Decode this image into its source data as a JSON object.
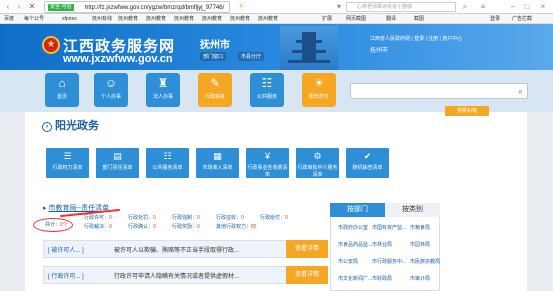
{
  "browser": {
    "safe_label": "安全·可信",
    "url": "http://fz.jxzwfww.gov.cn/ygzw/bmzrqd/bmfljyj_97746/",
    "search_placeholder": "心疼老师赋诗说道小猫咖",
    "bookmarks": [
      "百度",
      "每个公号",
      "sfpnes",
      "抚州有线",
      "抚州教育",
      "抚州教育",
      "抚州教育",
      "抚州教育",
      "抚州教育",
      "抚州教育"
    ],
    "right_tools": [
      "扩展",
      "网页截图",
      "翻译",
      "截图",
      "登录",
      "广告拦截"
    ]
  },
  "header": {
    "emblem_glyph": "★",
    "site_name": "江西政务服务网",
    "domain": "www.jxzwfww.gov.cn",
    "city": "抚州市",
    "dept_pill": "部门窗口",
    "county_pill": "市县分厅",
    "top_links": "江西省人民政府网  |  登录  |  注册  |  用户中心",
    "top_city": "抚州市"
  },
  "menu": [
    {
      "label": "首页",
      "glyph": "⌂",
      "color": "#2e8fd6"
    },
    {
      "label": "个人办事",
      "glyph": "☺",
      "color": "#2e8fd6"
    },
    {
      "label": "法人办事",
      "glyph": "♜",
      "color": "#2e8fd6"
    },
    {
      "label": "行政审批",
      "glyph": "✎",
      "color": "#f5a623"
    },
    {
      "label": "公共服务",
      "glyph": "☷",
      "color": "#2e8fd6"
    },
    {
      "label": "阳光政务",
      "glyph": "☀",
      "color": "#f5a623"
    }
  ],
  "yjfk_label": "我要纠错",
  "section_title": "阳光政务",
  "tabs": [
    "行政权力清单",
    "部门责任清单",
    "公共服务清单",
    "市场准入清单",
    "行政事业性收费清单",
    "行政审批中介服务清单",
    "随机抽查清单"
  ],
  "list": {
    "title": "市教育局--责任清单",
    "stats": [
      {
        "label": "共计：",
        "value": "0个"
      },
      {
        "label": "行政许可：",
        "value": "0"
      },
      {
        "label": "行政处罚：",
        "value": "0"
      },
      {
        "label": "行政强制：",
        "value": "0"
      },
      {
        "label": "行政征收：",
        "value": "0"
      },
      {
        "label": "行政给付：",
        "value": "0"
      },
      {
        "label": "行政裁决：",
        "value": "0"
      },
      {
        "label": "行政确认：",
        "value": "0"
      },
      {
        "label": "行政奖励：",
        "value": "0"
      },
      {
        "label": "其他行政权力：",
        "value": "85"
      }
    ],
    "rows": [
      {
        "kind": "[ 被许可人... ]",
        "desc": "被许可人以欺骗、贿赂等不正当手段取得行政...",
        "action": "查看详情"
      },
      {
        "kind": "[ 行政许可... ]",
        "desc": "行政许可申请人隐瞒有关情况或者提供虚假材...",
        "action": "查看详情"
      }
    ]
  },
  "side": {
    "tab_dept": "按部门",
    "tab_theme": "按类别",
    "depts": [
      "市政府办公室",
      "市国有资产监...",
      "市粮食局",
      "市食品药品监...",
      "市林业局",
      "市园林局",
      "市公安局",
      "市行政服务中...",
      "市民族宗教局",
      "市文化新闻广...",
      "市财政局",
      "市审计局"
    ]
  }
}
